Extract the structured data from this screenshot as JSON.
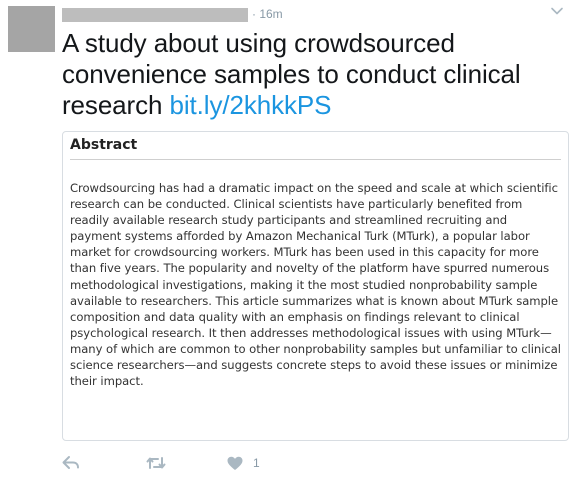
{
  "tweet": {
    "time": "· 16m",
    "text": "A study about using crowdsourced convenience samples to conduct clinical research ",
    "link": "bit.ly/2khkkPS"
  },
  "card": {
    "heading": "Abstract",
    "body": "Crowdsourcing has had a dramatic impact on the speed and scale at which scientific research can be conducted. Clinical scientists have particularly benefited from readily available research study participants and streamlined recruiting and payment systems afforded by Amazon Mechanical Turk (MTurk), a popular labor market for crowdsourcing workers. MTurk has been used in this capacity for more than five years. The popularity and novelty of the platform have spurred numerous methodological investigations, making it the most studied nonprobability sample available to researchers. This article summarizes what is known about MTurk sample composition and data quality with an emphasis on findings relevant to clinical psychological research. It then addresses methodological issues with using MTurk—many of which are common to other nonprobability samples but unfamiliar to clinical science researchers—and suggests concrete steps to avoid these issues or minimize their impact."
  },
  "actions": {
    "like_count": "1"
  },
  "icons": {
    "avatar": "avatar",
    "caret": "chevron-down-icon",
    "reply": "reply-icon",
    "retweet": "retweet-icon",
    "like": "heart-icon"
  },
  "colors": {
    "link": "#1b95e0",
    "muted": "#aab8c2"
  }
}
